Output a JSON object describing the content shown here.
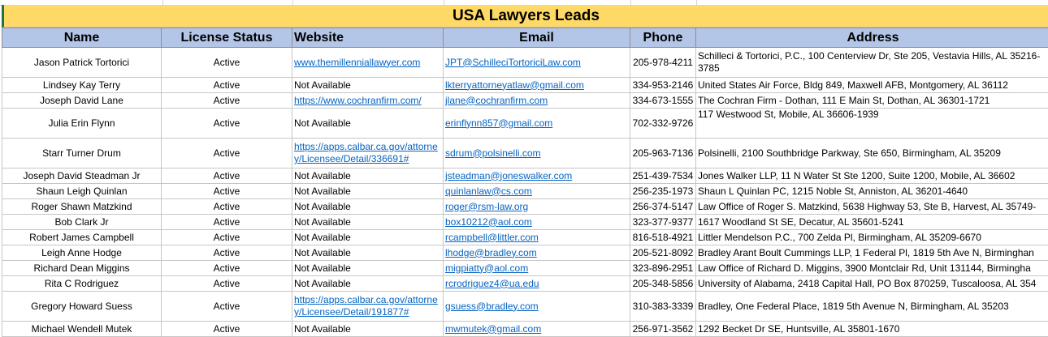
{
  "sheet": {
    "title": "USA Lawyers Leads",
    "columns": [
      "Name",
      "License Status",
      "Website",
      "Email",
      "Phone",
      "Address"
    ],
    "rows": [
      {
        "name": "Jason Patrick Tortorici",
        "status": "Active",
        "website": "www.themillenniallawyer.com",
        "website_link": true,
        "email": "JPT@SchilleciTortoriciLaw.com",
        "phone": "205-978-4211",
        "address": "Schilleci & Tortorici, P.C., 100 Centerview Dr, Ste 205, Vestavia Hills, AL 35216-3785",
        "tall": true
      },
      {
        "name": "Lindsey Kay Terry",
        "status": "Active",
        "website": "Not Available",
        "website_link": false,
        "email": "lkterryattorneyatlaw@gmail.com",
        "phone": "334-953-2146",
        "address": "United States Air Force, Bldg 849, Maxwell AFB, Montgomery, AL 36112",
        "tall": false
      },
      {
        "name": "Joseph David Lane",
        "status": "Active",
        "website": "https://www.cochranfirm.com/",
        "website_link": true,
        "email": "jlane@cochranfirm.com",
        "phone": "334-673-1555",
        "address": "The Cochran Firm - Dothan, 111 E Main St, Dothan, AL 36301-1721",
        "tall": false
      },
      {
        "name": "Julia Erin Flynn",
        "status": "Active",
        "website": "Not Available",
        "website_link": false,
        "email": "erinflynn857@gmail.com",
        "phone": "702-332-9726",
        "address": "117 Westwood St, Mobile, AL 36606-1939",
        "tall": true,
        "addr_top": true
      },
      {
        "name": "Starr Turner Drum",
        "status": "Active",
        "website": "https://apps.calbar.ca.gov/attorney/Licensee/Detail/336691#",
        "website_link": true,
        "email": "sdrum@polsinelli.com",
        "phone": "205-963-7136",
        "address": "Polsinelli, 2100 Southbridge Parkway, Ste 650, Birmingham, AL 35209",
        "tall": true
      },
      {
        "name": "Joseph David Steadman Jr",
        "status": "Active",
        "website": "Not Available",
        "website_link": false,
        "email": "jsteadman@joneswalker.com",
        "phone": "251-439-7534",
        "address": "Jones Walker LLP, 11 N Water St Ste 1200, Suite 1200, Mobile, AL 36602",
        "tall": false
      },
      {
        "name": "Shaun Leigh Quinlan",
        "status": "Active",
        "website": "Not Available",
        "website_link": false,
        "email": "quinlanlaw@cs.com",
        "phone": "256-235-1973",
        "address": "Shaun L Quinlan PC, 1215 Noble St, Anniston, AL 36201-4640",
        "tall": false
      },
      {
        "name": "Roger Shawn Matzkind",
        "status": "Active",
        "website": "Not Available",
        "website_link": false,
        "email": "roger@rsm-law.org",
        "phone": "256-374-5147",
        "address": "Law Office of Roger S. Matzkind, 5638 Highway 53, Ste B, Harvest, AL 35749-",
        "tall": false
      },
      {
        "name": "Bob Clark Jr",
        "status": "Active",
        "website": "Not Available",
        "website_link": false,
        "email": "box10212@aol.com",
        "phone": "323-377-9377",
        "address": "1617 Woodland St SE, Decatur, AL 35601-5241",
        "tall": false
      },
      {
        "name": "Robert James Campbell",
        "status": "Active",
        "website": "Not Available",
        "website_link": false,
        "email": "rcampbell@littler.com",
        "phone": "816-518-4921",
        "address": "Littler Mendelson P.C., 700 Zelda Pl, Birmingham, AL 35209-6670",
        "tall": false
      },
      {
        "name": "Leigh Anne Hodge",
        "status": "Active",
        "website": "Not Available",
        "website_link": false,
        "email": "lhodge@bradley.com",
        "phone": "205-521-8092",
        "address": "Bradley Arant Boult Cummings LLP, 1 Federal Pl, 1819 5th Ave N, Birminghan",
        "tall": false
      },
      {
        "name": "Richard Dean Miggins",
        "status": "Active",
        "website": "Not Available",
        "website_link": false,
        "email": "migpiatty@aol.com",
        "phone": "323-896-2951",
        "address": "Law Office of Richard D. Miggins, 3900 Montclair Rd, Unit 131144, Birmingha",
        "tall": false
      },
      {
        "name": "Rita C Rodriguez",
        "status": "Active",
        "website": "Not Available",
        "website_link": false,
        "email": "rcrodriguez4@ua.edu",
        "phone": "205-348-5856",
        "address": "University of Alabama, 2418 Capital Hall, PO Box 870259, Tuscaloosa, AL 354",
        "tall": false
      },
      {
        "name": "Gregory Howard Suess",
        "status": "Active",
        "website": "https://apps.calbar.ca.gov/attorney/Licensee/Detail/191877#",
        "website_link": true,
        "email": "gsuess@bradley.com",
        "phone": "310-383-3339",
        "address": "Bradley, One Federal Place, 1819 5th Avenue N, Birmingham, AL 35203",
        "tall": true
      },
      {
        "name": "Michael Wendell Mutek",
        "status": "Active",
        "website": "Not Available",
        "website_link": false,
        "email": "mwmutek@gmail.com",
        "phone": "256-971-3562",
        "address": "1292 Becket Dr SE, Huntsville, AL 35801-1670",
        "tall": false
      }
    ]
  },
  "colors": {
    "title_bg": "#ffd966",
    "header_bg": "#b4c6e7",
    "link": "#0563c1",
    "active_cell_border": "#217346"
  }
}
